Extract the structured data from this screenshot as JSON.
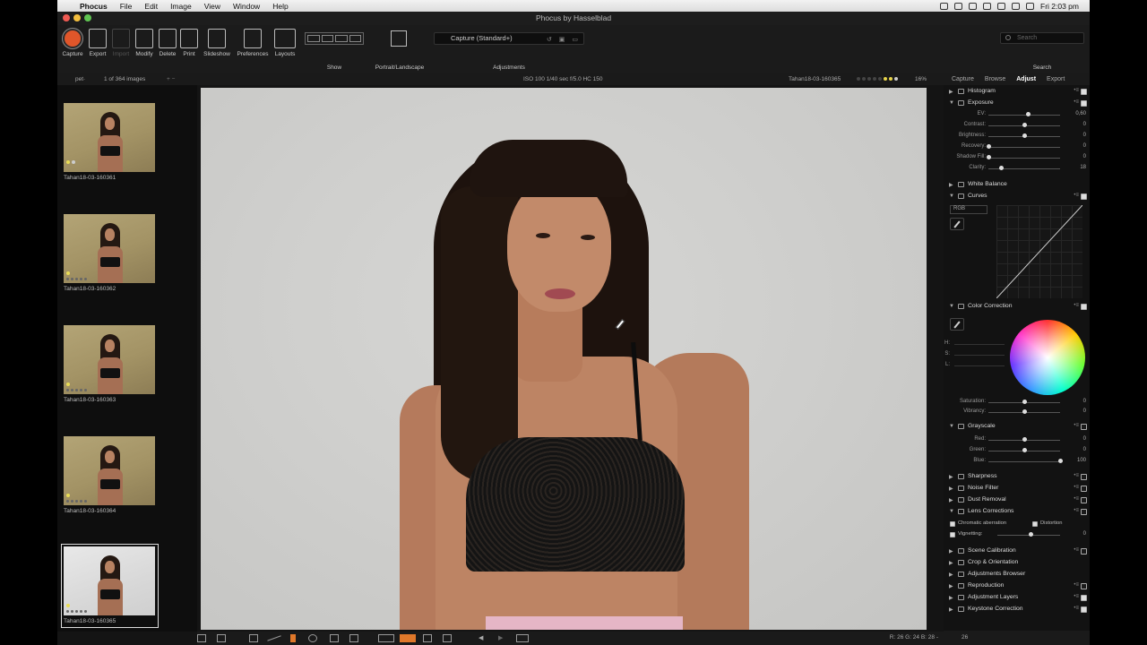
{
  "menubar": {
    "app": "Phocus",
    "items": [
      "File",
      "Edit",
      "Image",
      "View",
      "Window",
      "Help"
    ],
    "clock": "Fri 2:03 pm"
  },
  "window": {
    "title": "Phocus by Hasselblad"
  },
  "toolbar": {
    "capture": "Capture",
    "export": "Export",
    "import": "Import",
    "modify": "Modify",
    "delete": "Delete",
    "print": "Print",
    "slideshow": "Slideshow",
    "preferences": "Preferences",
    "layouts": "Layouts",
    "show": "Show",
    "portrait_landscape": "Portrait/Landscape",
    "adjustments_value": "Capture (Standard+)",
    "adjustments": "Adjustments",
    "search_placeholder": "Search",
    "search": "Search"
  },
  "infobar": {
    "folder": "pet·",
    "count": "1 of 364 images",
    "exif": "ISO 100  1/40 sec  f/5.0  HC 150",
    "filename": "Tahan18-03-160365",
    "zoom": "16%",
    "tabs": [
      "Capture",
      "Browse",
      "Adjust",
      "Export"
    ],
    "active_tab": "Adjust"
  },
  "thumbnails": [
    {
      "name": "Tahan18-03-160361"
    },
    {
      "name": "Tahan18-03-160362"
    },
    {
      "name": "Tahan18-03-160363"
    },
    {
      "name": "Tahan18-03-160364"
    },
    {
      "name": "Tahan18-03-160365"
    }
  ],
  "bottombar": {
    "readout": "R: 26  G: 24  B: 28  -"
  },
  "panel": {
    "histogram": "Histogram",
    "exposure": "Exposure",
    "exposure_sliders": [
      {
        "label": "EV:",
        "value": "0,60",
        "level": 0.55
      },
      {
        "label": "Contrast:",
        "value": "0",
        "level": 0.5
      },
      {
        "label": "Brightness:",
        "value": "0",
        "level": 0.5
      },
      {
        "label": "Recovery:",
        "value": "0",
        "level": 0.0
      },
      {
        "label": "Shadow Fill:",
        "value": "0",
        "level": 0.0
      },
      {
        "label": "Clarity:",
        "value": "18",
        "level": 0.18
      }
    ],
    "white_balance": "White Balance",
    "curves": "Curves",
    "curves_channel": "RGB",
    "color_correction": "Color Correction",
    "hsl": [
      "H:",
      "S:",
      "L:"
    ],
    "color_sliders": [
      {
        "label": "Saturation:",
        "value": "0",
        "level": 0.5
      },
      {
        "label": "Vibrancy:",
        "value": "0",
        "level": 0.5
      }
    ],
    "grayscale": "Grayscale",
    "grayscale_sliders": [
      {
        "label": "Red:",
        "value": "0",
        "level": 0.5
      },
      {
        "label": "Green:",
        "value": "0",
        "level": 0.5
      },
      {
        "label": "Blue:",
        "value": "100",
        "level": 1.0
      }
    ],
    "sharpness": "Sharpness",
    "noise_filter": "Noise Filter",
    "dust_removal": "Dust Removal",
    "lens_corrections": "Lens Corrections",
    "chromatic_aberration": "Chromatic aberration",
    "distortion": "Distortion",
    "vignetting": "Vignetting:",
    "vignetting_value": "0",
    "scene_calibration": "Scene Calibration",
    "crop_orientation": "Crop & Orientation",
    "adjustments_browser": "Adjustments Browser",
    "reproduction": "Reproduction",
    "adjustment_layers": "Adjustment Layers",
    "keystone_correction": "Keystone Correction",
    "footer": "26"
  },
  "colors": {
    "accent": "#e0562a",
    "rating_yellow": "#e7d44a"
  }
}
